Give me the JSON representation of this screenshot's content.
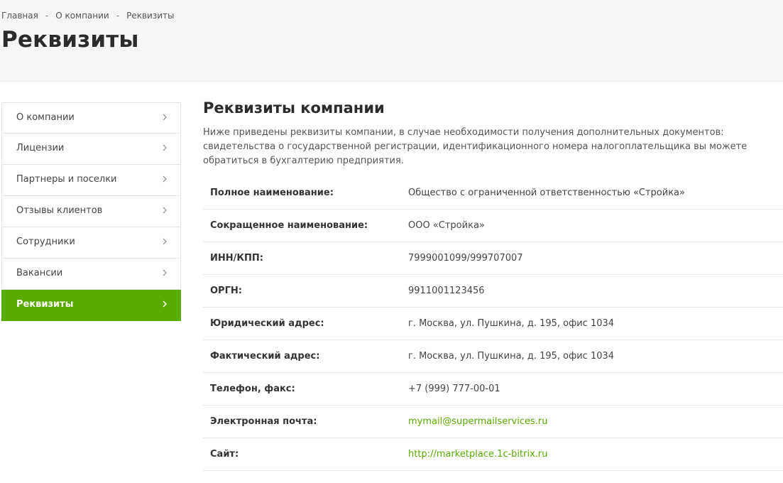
{
  "breadcrumb": {
    "items": [
      "Главная",
      "О компании",
      "Реквизиты"
    ],
    "separator": "-"
  },
  "page_title": "Реквизиты",
  "sidebar": {
    "items": [
      {
        "label": "О компании",
        "icon": "chevron-right-icon"
      },
      {
        "label": "Лицензии",
        "icon": "chevron-right-icon"
      },
      {
        "label": "Партнеры и поселки",
        "icon": "chevron-right-icon"
      },
      {
        "label": "Отзывы клиентов",
        "icon": "chevron-right-icon"
      },
      {
        "label": "Сотрудники",
        "icon": "chevron-right-icon"
      },
      {
        "label": "Вакансии",
        "icon": "chevron-right-icon"
      },
      {
        "label": "Реквизиты",
        "icon": "chevron-right-icon",
        "active": true
      }
    ]
  },
  "content": {
    "title": "Реквизиты компании",
    "intro": "Ниже приведены реквизиты компании, в случае необходимости получения дополнительных документов: свидетельства о государственной регистрации, идентификационного номера налогоплательщика вы можете обратиться в бухгалтерию предприятия.",
    "rows": [
      {
        "key": "Полное наименование:",
        "value": "Общество с ограниченной ответственностью «Стройка»"
      },
      {
        "key": "Сокращенное наименование:",
        "value": "ООО «Стройка»"
      },
      {
        "key": "ИНН/КПП:",
        "value": "7999001099/999707007"
      },
      {
        "key": "ОРГН:",
        "value": "9911001123456"
      },
      {
        "key": "Юридический адрес:",
        "value": "г. Москва, ул. Пушкина, д. 195, офис 1034"
      },
      {
        "key": "Фактический адрес:",
        "value": "г. Москва, ул. Пушкина, д. 195, офис 1034"
      },
      {
        "key": "Телефон, факс:",
        "value": "+7 (999) 777-00-01"
      },
      {
        "key": "Электронная почта:",
        "value": "mymail@supermailservices.ru",
        "link": true
      },
      {
        "key": "Сайт:",
        "value": "http://marketplace.1c-bitrix.ru",
        "link": true
      }
    ]
  },
  "colors": {
    "accent": "#5aab00",
    "header_bg": "#f6f6f6",
    "text": "#333333",
    "border": "#e6e6e6"
  }
}
